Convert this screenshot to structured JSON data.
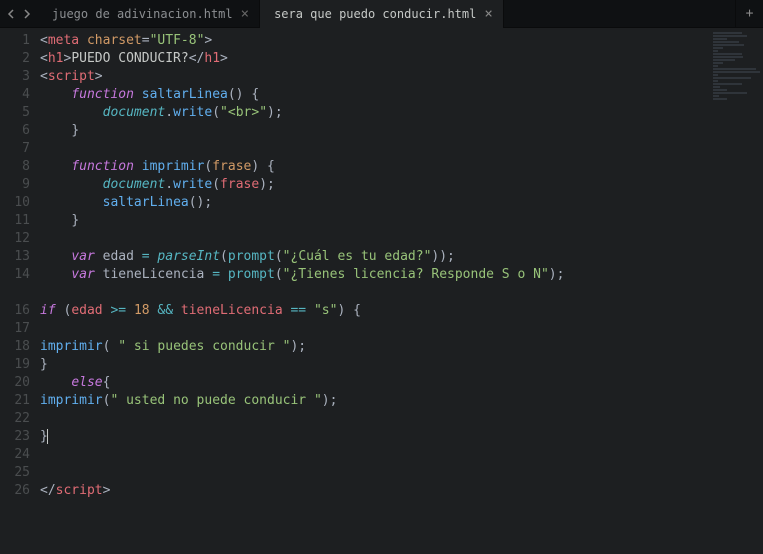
{
  "tabs": {
    "items": [
      {
        "label": "juego de adivinacion.html",
        "active": false
      },
      {
        "label": "sera que puedo conducir.html",
        "active": true
      }
    ]
  },
  "line_numbers": [
    "1",
    "2",
    "3",
    "4",
    "5",
    "6",
    "7",
    "8",
    "9",
    "10",
    "11",
    "12",
    "13",
    "14",
    "",
    "16",
    "17",
    "18",
    "19",
    "20",
    "21",
    "22",
    "23",
    "24",
    "25",
    "26"
  ],
  "code": {
    "l1": {
      "open": "<",
      "tag": "meta",
      "sp": " ",
      "attr": "charset",
      "eq": "=",
      "q1": "\"",
      "val": "UTF-8",
      "q2": "\"",
      "close": ">"
    },
    "l2": {
      "open": "<",
      "tag": "h1",
      "gt": ">",
      "text": "PUEDO CONDUCIR?",
      "o2": "</",
      "tag2": "h1",
      "c2": ">"
    },
    "l3": {
      "open": "<",
      "tag": "script",
      "close": ">"
    },
    "l4": {
      "kw": "function",
      "name": " saltarLinea",
      "paren": "() {"
    },
    "l5": {
      "obj": "document",
      "dot": ".",
      "meth": "write",
      "open": "(",
      "q": "\"",
      "str": "<br>",
      "q2": "\"",
      "close": ");"
    },
    "l6": {
      "brace": "}"
    },
    "l8": {
      "kw": "function",
      "name": " imprimir",
      "open": "(",
      "param": "frase",
      "close": ") {"
    },
    "l9": {
      "obj": "document",
      "dot": ".",
      "meth": "write",
      "open": "(",
      "param": "frase",
      "close": ");"
    },
    "l10": {
      "call": "saltarLinea",
      "rest": "();"
    },
    "l11": {
      "brace": "}"
    },
    "l13": {
      "kw": "var",
      "name": " edad ",
      "eq": "= ",
      "fn": "parseInt",
      "open": "(",
      "pr": "prompt",
      "p2": "(",
      "q": "\"",
      "str": "¿Cuál es tu edad?",
      "q2": "\"",
      "close": "));"
    },
    "l14": {
      "kw": "var",
      "name": " tieneLicencia ",
      "eq": "= ",
      "pr": "prompt",
      "open": "(",
      "q": "\"",
      "str": "¿Tienes licencia? Responde S o N",
      "q2": "\"",
      "close": ");"
    },
    "l16": {
      "kw": "if",
      "open": " (",
      "v1": "edad",
      "op1": " >= ",
      "n": "18",
      "op2": " && ",
      "v2": "tieneLicencia",
      "op3": " == ",
      "q": "\"",
      "s": "s",
      "q2": "\"",
      "close": ") {"
    },
    "l18": {
      "fn": "imprimir",
      "open": "( ",
      "q": "\"",
      "str": " si puedes conducir ",
      "q2": "\"",
      "close": ");"
    },
    "l19": {
      "brace": "}"
    },
    "l20": {
      "kw": "else",
      "brace": "{"
    },
    "l21": {
      "fn": "imprimir",
      "open": "(",
      "q": "\"",
      "str": " usted no puede conducir ",
      "q2": "\"",
      "close": ");"
    },
    "l23": {
      "brace": "}"
    },
    "l26": {
      "open": "</",
      "tag": "script",
      "close": ">"
    }
  }
}
